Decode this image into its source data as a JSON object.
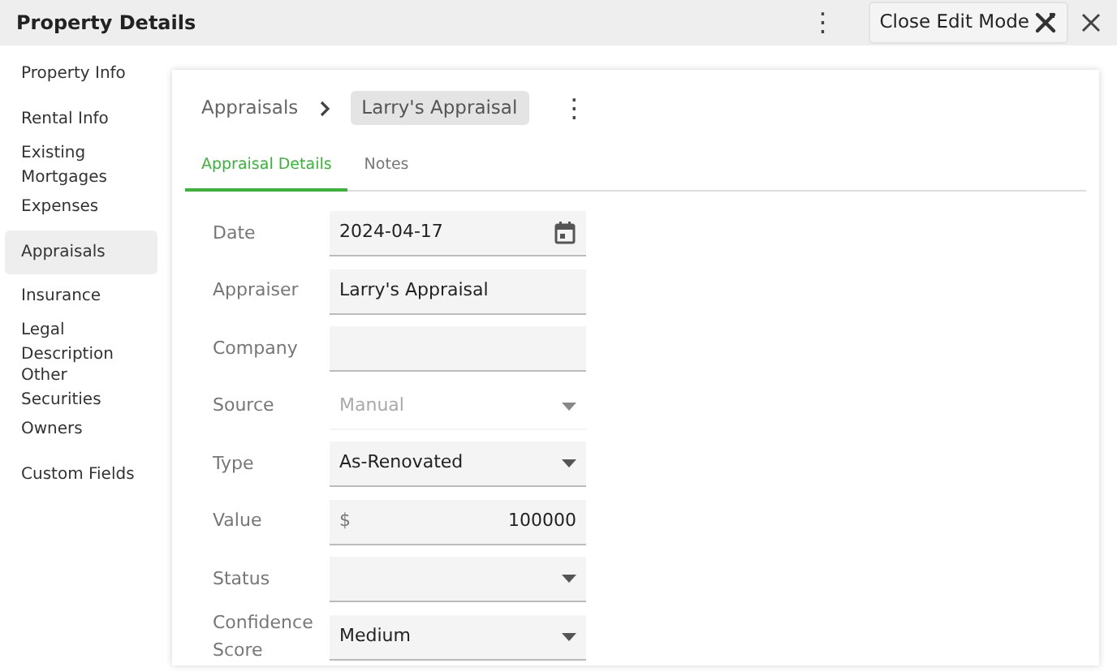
{
  "header": {
    "title": "Property Details",
    "menu_icon": "⋮",
    "edit_button": "Close Edit Mode"
  },
  "sidebar": {
    "items": [
      {
        "label": "Property Info",
        "selected": false
      },
      {
        "label": "Rental Info",
        "selected": false
      },
      {
        "label": "Existing Mortgages",
        "selected": false
      },
      {
        "label": "Expenses",
        "selected": false
      },
      {
        "label": "Appraisals",
        "selected": true
      },
      {
        "label": "Insurance",
        "selected": false
      },
      {
        "label": "Legal Description",
        "selected": false
      },
      {
        "label": "Other Securities",
        "selected": false
      },
      {
        "label": "Owners",
        "selected": false
      },
      {
        "label": "Custom Fields",
        "selected": false
      }
    ]
  },
  "breadcrumb": {
    "parent": "Appraisals",
    "current": "Larry's Appraisal"
  },
  "tabs": [
    {
      "label": "Appraisal Details",
      "selected": true
    },
    {
      "label": "Notes",
      "selected": false
    }
  ],
  "fields": [
    {
      "label": "Date",
      "kind": "date",
      "value": "2024-04-17",
      "disabled": false
    },
    {
      "label": "Appraiser",
      "kind": "text",
      "value": "Larry's Appraisal",
      "disabled": false
    },
    {
      "label": "Company",
      "kind": "text",
      "disabled": false
    },
    {
      "label": "Source",
      "kind": "select",
      "value": "Manual",
      "disabled": true
    },
    {
      "label": "Type",
      "kind": "select",
      "value": "As-Renovated",
      "disabled": false
    },
    {
      "label": "Value",
      "kind": "currency",
      "prefix": "$",
      "value": "100000",
      "disabled": false
    },
    {
      "label": "Status",
      "kind": "select",
      "disabled": false
    },
    {
      "label": "Confidence Score",
      "kind": "select",
      "value": "Medium",
      "disabled": false
    }
  ]
}
